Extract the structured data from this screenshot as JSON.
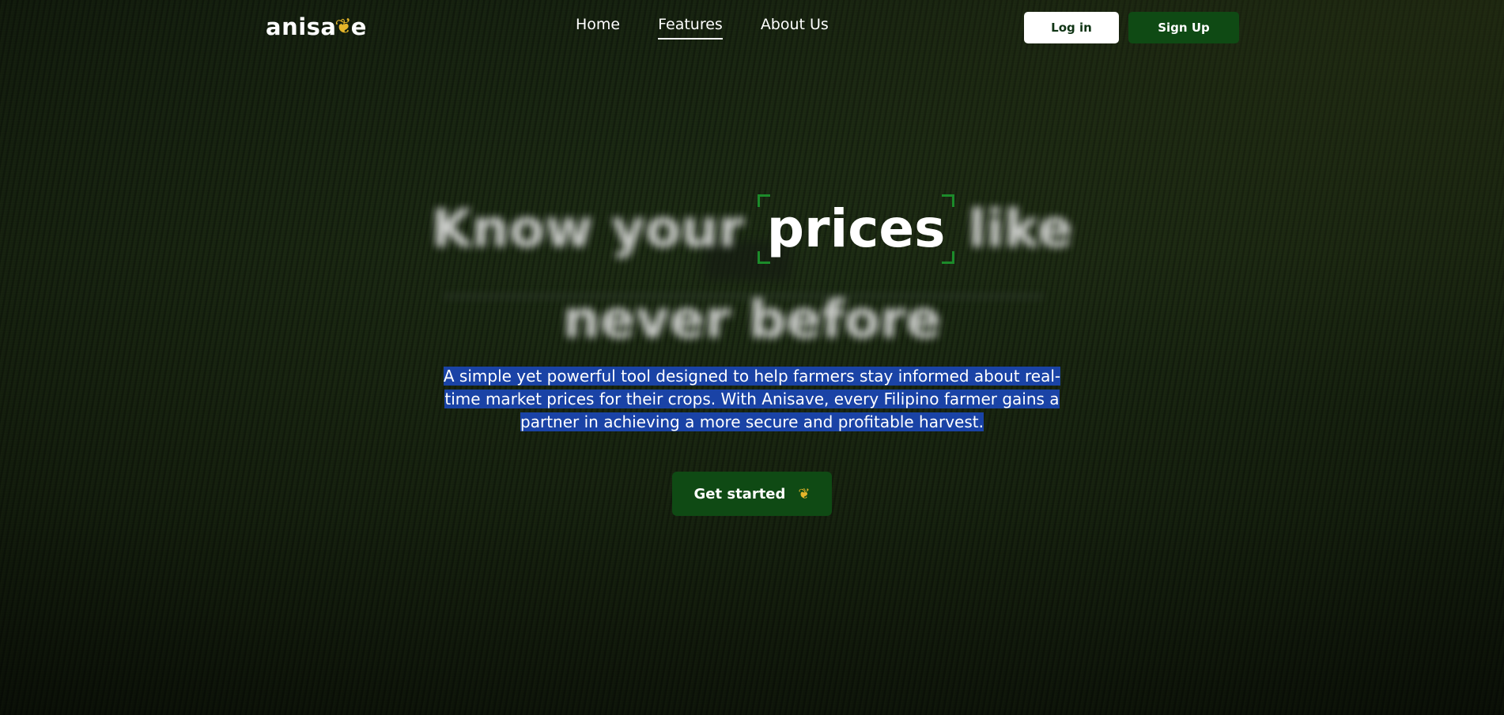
{
  "brand": {
    "name_prefix": "anisa",
    "name_suffix": "e",
    "logo_icon": "wheat-icon"
  },
  "nav": {
    "links": [
      {
        "label": "Home",
        "active": false
      },
      {
        "label": "Features",
        "active": true
      },
      {
        "label": "About Us",
        "active": false
      }
    ],
    "login_label": "Log in",
    "signup_label": "Sign Up"
  },
  "hero": {
    "headline_before": "Know your",
    "headline_focus": "prices",
    "headline_after": "like",
    "headline_line2": "never before",
    "description": "A simple yet powerful tool designed to help farmers stay informed about real-time market prices for their crops. With Anisave, every Filipino farmer gains a partner in achieving a more secure and profitable harvest.",
    "cta_label": "Get started",
    "cta_icon": "wheat-icon"
  },
  "colors": {
    "primary_green": "#0f4a14",
    "accent_gold": "#e5b52a",
    "focus_corner": "#1c8b2a",
    "selection_highlight": "#1a43a6"
  }
}
